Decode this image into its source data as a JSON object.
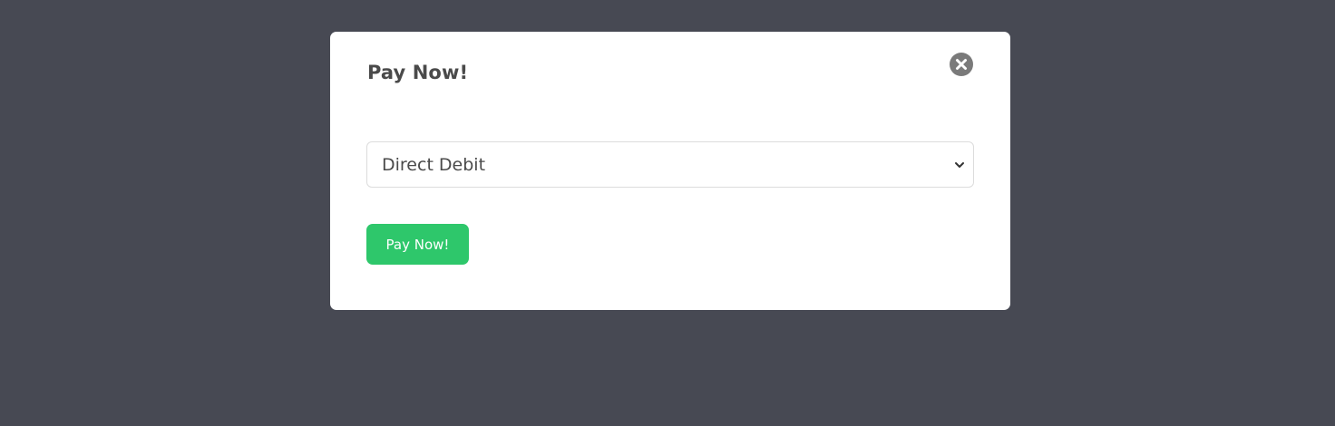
{
  "modal": {
    "title": "Pay Now!",
    "close_icon": "close-circle-icon",
    "payment_method": {
      "selected": "Direct Debit",
      "chevron_icon": "chevron-down-icon"
    },
    "submit_label": "Pay Now!"
  },
  "colors": {
    "overlay": "#474953",
    "modal_background": "#ffffff",
    "primary_button": "#2ec76b",
    "close_icon": "#7a7a7a",
    "text": "#4a4a4a"
  }
}
